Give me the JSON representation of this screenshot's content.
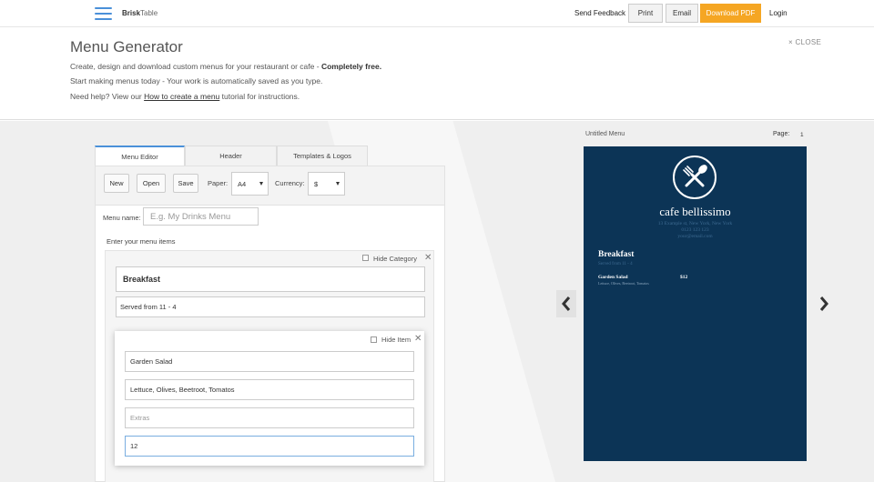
{
  "topbar": {
    "brand_main": "Brisk",
    "brand_light": "Table",
    "send_feedback": "Send Feedback",
    "print": "Print",
    "email": "Email",
    "download_pdf": "Download PDF",
    "login": "Login",
    "accent_color": "#f5a623"
  },
  "intro": {
    "title": "Menu Generator",
    "line1_prefix": "Create, design and download custom menus for your restaurant or cafe - ",
    "line1_bold": "Completely free.",
    "line2": "Start making menus today - Your work is automatically saved as you type.",
    "line3_prefix": "Need help? View our ",
    "line3_link": "How to create a menu",
    "line3_suffix": " tutorial for instructions.",
    "close": "× CLOSE"
  },
  "editor": {
    "tabs": [
      {
        "label": "Menu Editor",
        "active": true
      },
      {
        "label": "Header",
        "active": false
      },
      {
        "label": "Templates & Logos",
        "active": false
      }
    ],
    "toolbar": {
      "new": "New",
      "open": "Open",
      "save": "Save",
      "paper_label": "Paper:",
      "paper_value": "A4",
      "currency_label": "Currency:",
      "currency_value": "$"
    },
    "menu_name_label": "Menu name:",
    "menu_name_placeholder": "E.g. My Drinks Menu",
    "items_heading": "Enter your menu items",
    "category": {
      "hide_label": "Hide Category",
      "name": "Breakfast",
      "description": "Served from 11 - 4"
    },
    "item": {
      "hide_label": "Hide Item",
      "name": "Garden Salad",
      "description": "Lettuce, Olives, Beetroot, Tomatos",
      "extras_placeholder": "Extras",
      "price": "12"
    }
  },
  "preview": {
    "title": "Untitled Menu",
    "page_label": "Page:",
    "page_number": "1",
    "background_color": "#0c3456",
    "restaurant_name": "cafe bellissimo",
    "address": "13 Example st, New York, New York",
    "phone": "0123 123 123",
    "email": "your@email.com",
    "category": "Breakfast",
    "category_desc": "Served from 11 - 4",
    "item_name": "Garden Salad",
    "item_price": "$12",
    "item_desc": "Lettuce, Olives, Beetroot, Tomatos",
    "logo_icon": "spoon-fork-icon",
    "prev_icon": "chevron-left-icon",
    "next_icon": "chevron-right-icon"
  }
}
